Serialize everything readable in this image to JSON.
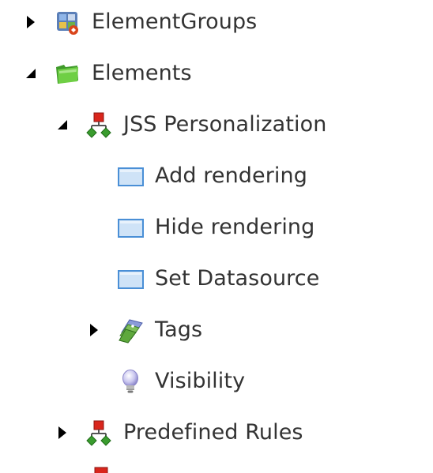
{
  "tree": {
    "nodes": [
      {
        "id": "element-groups",
        "label": "ElementGroups",
        "icon": "element-groups-icon",
        "state": "collapsed"
      },
      {
        "id": "elements",
        "label": "Elements",
        "icon": "green-folder-icon",
        "state": "expanded"
      },
      {
        "id": "jss-personalization",
        "label": "JSS Personalization",
        "icon": "hierarchy-icon",
        "state": "expanded"
      },
      {
        "id": "add-rendering",
        "label": "Add rendering",
        "icon": "window-icon",
        "state": "leaf"
      },
      {
        "id": "hide-rendering",
        "label": "Hide rendering",
        "icon": "window-icon",
        "state": "leaf"
      },
      {
        "id": "set-datasource",
        "label": "Set Datasource",
        "icon": "window-icon",
        "state": "leaf"
      },
      {
        "id": "tags",
        "label": "Tags",
        "icon": "tags-icon",
        "state": "collapsed"
      },
      {
        "id": "visibility",
        "label": "Visibility",
        "icon": "lightbulb-icon",
        "state": "leaf"
      },
      {
        "id": "predefined-rules",
        "label": "Predefined Rules",
        "icon": "hierarchy-icon",
        "state": "collapsed"
      },
      {
        "id": "next-item",
        "label": "",
        "icon": "hierarchy-icon",
        "state": "partially-visible"
      }
    ]
  },
  "colors": {
    "text": "#333333",
    "toggle": "#000000",
    "hierarchy_red": "#d9261c",
    "hierarchy_green": "#3a9c2e",
    "window_blue": "#4a8fd6",
    "folder_green": "#5cbf3a"
  }
}
